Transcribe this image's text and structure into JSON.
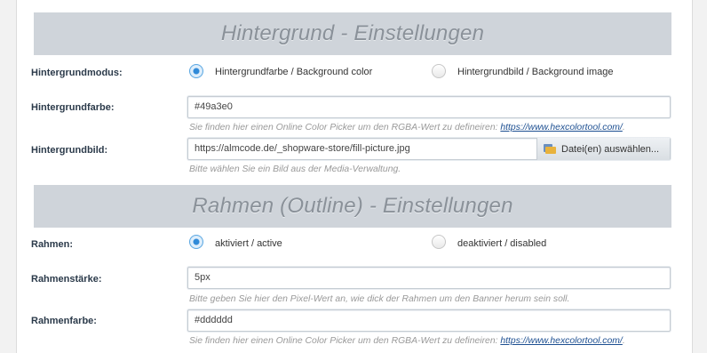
{
  "sections": [
    {
      "title": "Hintergrund - Einstellungen"
    },
    {
      "title": "Rahmen (Outline) - Einstellungen"
    }
  ],
  "background": {
    "mode_label": "Hintergrundmodus:",
    "mode_option_color": "Hintergrundfarbe / Background color",
    "mode_option_image": "Hintergrundbild / Background image",
    "mode_selected": "color",
    "color_label": "Hintergrundfarbe:",
    "color_value": "#49a3e0",
    "color_help_text": "Sie finden hier einen Online Color Picker um den RGBA-Wert zu defineiren: ",
    "color_help_link": "https://www.hexcolortool.com/",
    "color_help_suffix": ".",
    "image_label": "Hintergrundbild:",
    "image_value": "https://almcode.de/_shopware-store/fill-picture.jpg",
    "image_button": "Datei(en) auswählen...",
    "image_help": "Bitte wählen Sie ein Bild aus der Media-Verwaltung."
  },
  "border": {
    "label": "Rahmen:",
    "option_active": "aktiviert / active",
    "option_disabled": "deaktiviert / disabled",
    "selected": "active",
    "width_label": "Rahmenstärke:",
    "width_value": "5px",
    "width_help": "Bitte geben Sie hier den Pixel-Wert an, wie dick der Rahmen um den Banner herum sein soll.",
    "color_label": "Rahmenfarbe:",
    "color_value": "#dddddd",
    "color_help_text": "Sie finden hier einen Online Color Picker um den RGBA-Wert zu defineiren: ",
    "color_help_link": "https://www.hexcolortool.com/",
    "color_help_suffix": "."
  },
  "colors": {
    "section_header_bg": "#cfd4da",
    "section_header_text": "#8a9199",
    "radio_checked": "#2f8ad8",
    "link": "#1d4f91"
  }
}
